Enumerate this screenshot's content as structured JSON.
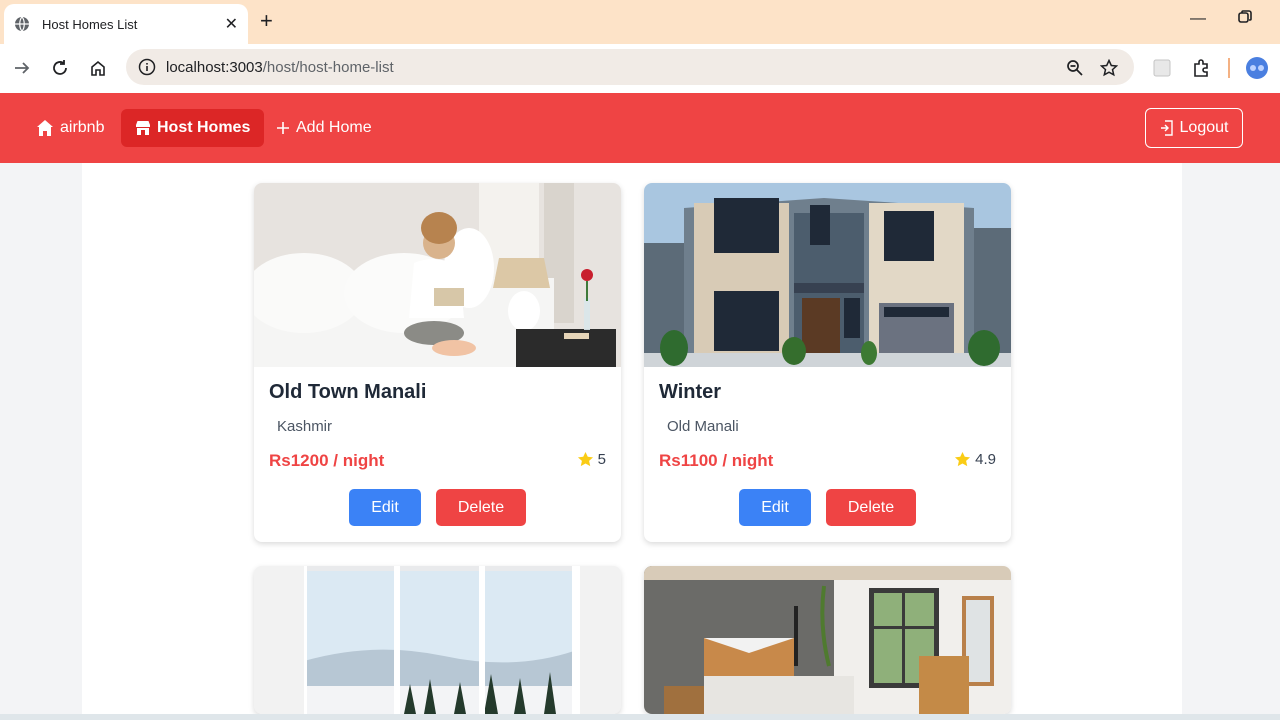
{
  "browser": {
    "tab_title": "Host Homes List",
    "new_tab_label": "+",
    "url_host": "localhost:3003",
    "url_path": "/host/host-home-list"
  },
  "navbar": {
    "brand": "airbnb",
    "host_homes": "Host Homes",
    "add_home": "Add Home",
    "logout": "Logout",
    "accent_color": "#ef4444"
  },
  "homes": [
    {
      "name": "Old Town Manali",
      "location": "Kashmir",
      "price": "Rs1200 / night",
      "rating": "5",
      "edit": "Edit",
      "delete": "Delete"
    },
    {
      "name": "Winter",
      "location": "Old Manali",
      "price": "Rs1100 / night",
      "rating": "4.9",
      "edit": "Edit",
      "delete": "Delete"
    }
  ]
}
